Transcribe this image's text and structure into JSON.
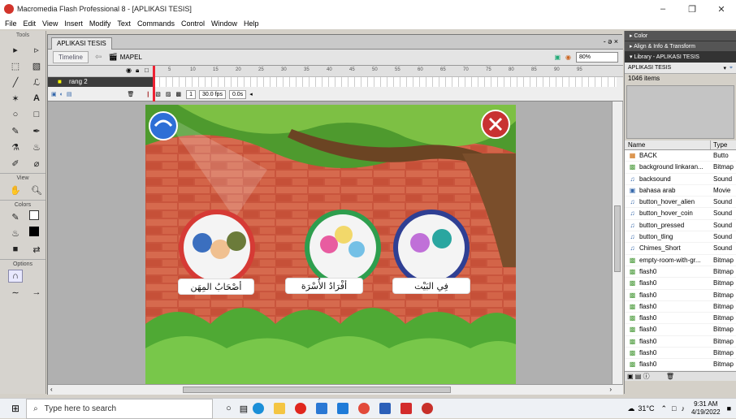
{
  "window": {
    "title": "Macromedia Flash Professional 8 - [APLIKASI TESIS]",
    "minimize": "–",
    "restore": "❐",
    "close": "✕"
  },
  "menu": [
    "File",
    "Edit",
    "View",
    "Insert",
    "Modify",
    "Text",
    "Commands",
    "Control",
    "Window",
    "Help"
  ],
  "tools": {
    "header": "Tools",
    "view_label": "View",
    "colors_label": "Colors",
    "options_label": "Options"
  },
  "document": {
    "tab": "APLIKASI TESIS",
    "tab_controls": "- ə ×",
    "timeline_button": "Timeline",
    "scene": "MAPEL",
    "zoom": "80%",
    "layer_name": "rang 2",
    "frame_number": "1",
    "fps": "30.0 fps",
    "time": "0.0s",
    "ruler": [
      "5",
      "10",
      "15",
      "20",
      "25",
      "30",
      "35",
      "40",
      "45",
      "50",
      "55",
      "60",
      "65",
      "70",
      "75",
      "80",
      "85",
      "90",
      "95"
    ]
  },
  "stage": {
    "labels": [
      "أصْحَابُ المِهَن",
      "أفْرَادُ الأُسْرَة",
      "فِي البَيْت"
    ]
  },
  "panels": {
    "color": "▸ Color",
    "align": "▸ Align & Info & Transform",
    "library": "▾ Library - APLIKASI TESIS",
    "library_select": "APLIKASI TESIS",
    "item_count": "1046 items",
    "col_name": "Name",
    "col_type": "Type",
    "items": [
      {
        "name": "BACK",
        "type": "Butto",
        "icon": "button-icon"
      },
      {
        "name": "background linkaran...",
        "type": "Bitmap",
        "icon": "bitmap-icon"
      },
      {
        "name": "backsound",
        "type": "Sound",
        "icon": "sound-icon"
      },
      {
        "name": "bahasa arab",
        "type": "Movie",
        "icon": "movie-icon"
      },
      {
        "name": "button_hover_alien",
        "type": "Sound",
        "icon": "sound-icon"
      },
      {
        "name": "button_hover_coin",
        "type": "Sound",
        "icon": "sound-icon"
      },
      {
        "name": "button_pressed",
        "type": "Sound",
        "icon": "sound-icon"
      },
      {
        "name": "button_tling",
        "type": "Sound",
        "icon": "sound-icon"
      },
      {
        "name": "Chimes_Short",
        "type": "Sound",
        "icon": "sound-icon"
      },
      {
        "name": "empty-room-with-gr...",
        "type": "Bitmap",
        "icon": "bitmap-icon"
      },
      {
        "name": "flash0",
        "type": "Bitmap",
        "icon": "bitmap-icon"
      },
      {
        "name": "flash0",
        "type": "Bitmap",
        "icon": "bitmap-icon"
      },
      {
        "name": "flash0",
        "type": "Bitmap",
        "icon": "bitmap-icon"
      },
      {
        "name": "flash0",
        "type": "Bitmap",
        "icon": "bitmap-icon"
      },
      {
        "name": "flash0",
        "type": "Bitmap",
        "icon": "bitmap-icon"
      },
      {
        "name": "flash0",
        "type": "Bitmap",
        "icon": "bitmap-icon"
      },
      {
        "name": "flash0",
        "type": "Bitmap",
        "icon": "bitmap-icon"
      },
      {
        "name": "flash0",
        "type": "Bitmap",
        "icon": "bitmap-icon"
      },
      {
        "name": "flash0",
        "type": "Bitmap",
        "icon": "bitmap-icon"
      }
    ]
  },
  "taskbar": {
    "search_placeholder": "Type here to search",
    "weather": "31°C",
    "time": "9:31 AM",
    "date": "4/19/2022"
  },
  "colors": {
    "accent": "#d2342b",
    "stage_brick": "#c94c38",
    "library_header": "#333333"
  }
}
